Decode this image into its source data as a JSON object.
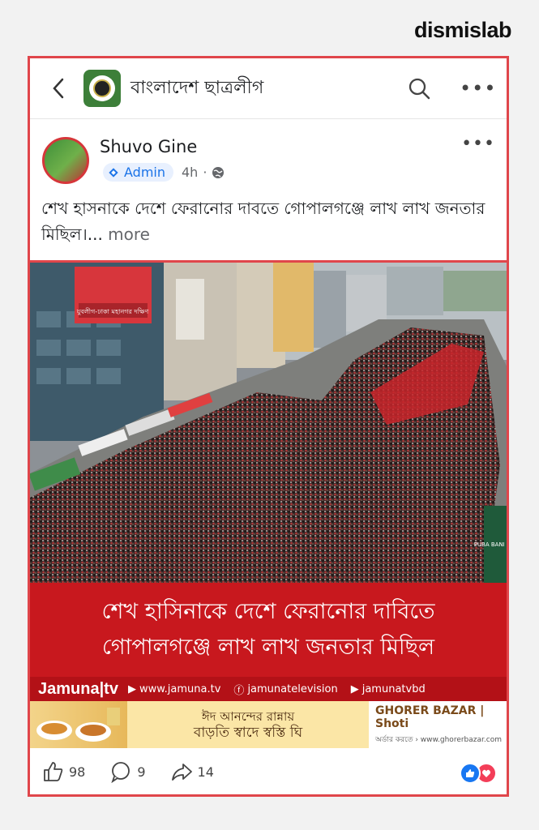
{
  "watermark": "dismislab",
  "group": {
    "name": "বাংলাদেশ ছাত্রলীগ",
    "icons": {
      "back": "back-arrow-icon",
      "search": "search-icon",
      "more": "more-options-icon"
    }
  },
  "post": {
    "author": "Shuvo Gine",
    "role": "Admin",
    "time": "4h",
    "separator": "·",
    "privacy_icon": "globe-icon",
    "text": "শেখ হাসনাকে দেশে ফেরানোর দাবতে গোপালগঞ্জে লাখ লাখ জনতার মিছিল।...",
    "more_label": "more",
    "more_options": "•••"
  },
  "image": {
    "shop_sign": "যুবলীগ-ঢাকা মহানগর দক্ষিণ",
    "bank_sign": "PUBA BANI LIMIT"
  },
  "banner": {
    "line1": "শেখ হাসিনাকে দেশে ফেরানোর দাবিতে",
    "line2": "গোপালগঞ্জে লাখ লাখ জনতার মিছিল"
  },
  "brandbar": {
    "logo": "Jamuna|tv",
    "web": "www.jamuna.tv",
    "facebook": "jamunatelevision",
    "youtube": "jamunatvbd"
  },
  "ad": {
    "line1": "ঈদ আনন্দের রান্নায়",
    "line2": "বাড়তি স্বাদে স্বস্তি ঘি",
    "brand1": "GHORER BAZAR",
    "brand2": "Shoti",
    "order": "অর্ডার করতে › www.ghorerbazar.com"
  },
  "reactions": {
    "likes": "98",
    "comments": "9",
    "shares": "14"
  },
  "colors": {
    "frame": "#e0464b",
    "banner": "#c8181e",
    "admin_badge": "#1a73e8",
    "like": "#1877f2",
    "love": "#f33e58"
  }
}
